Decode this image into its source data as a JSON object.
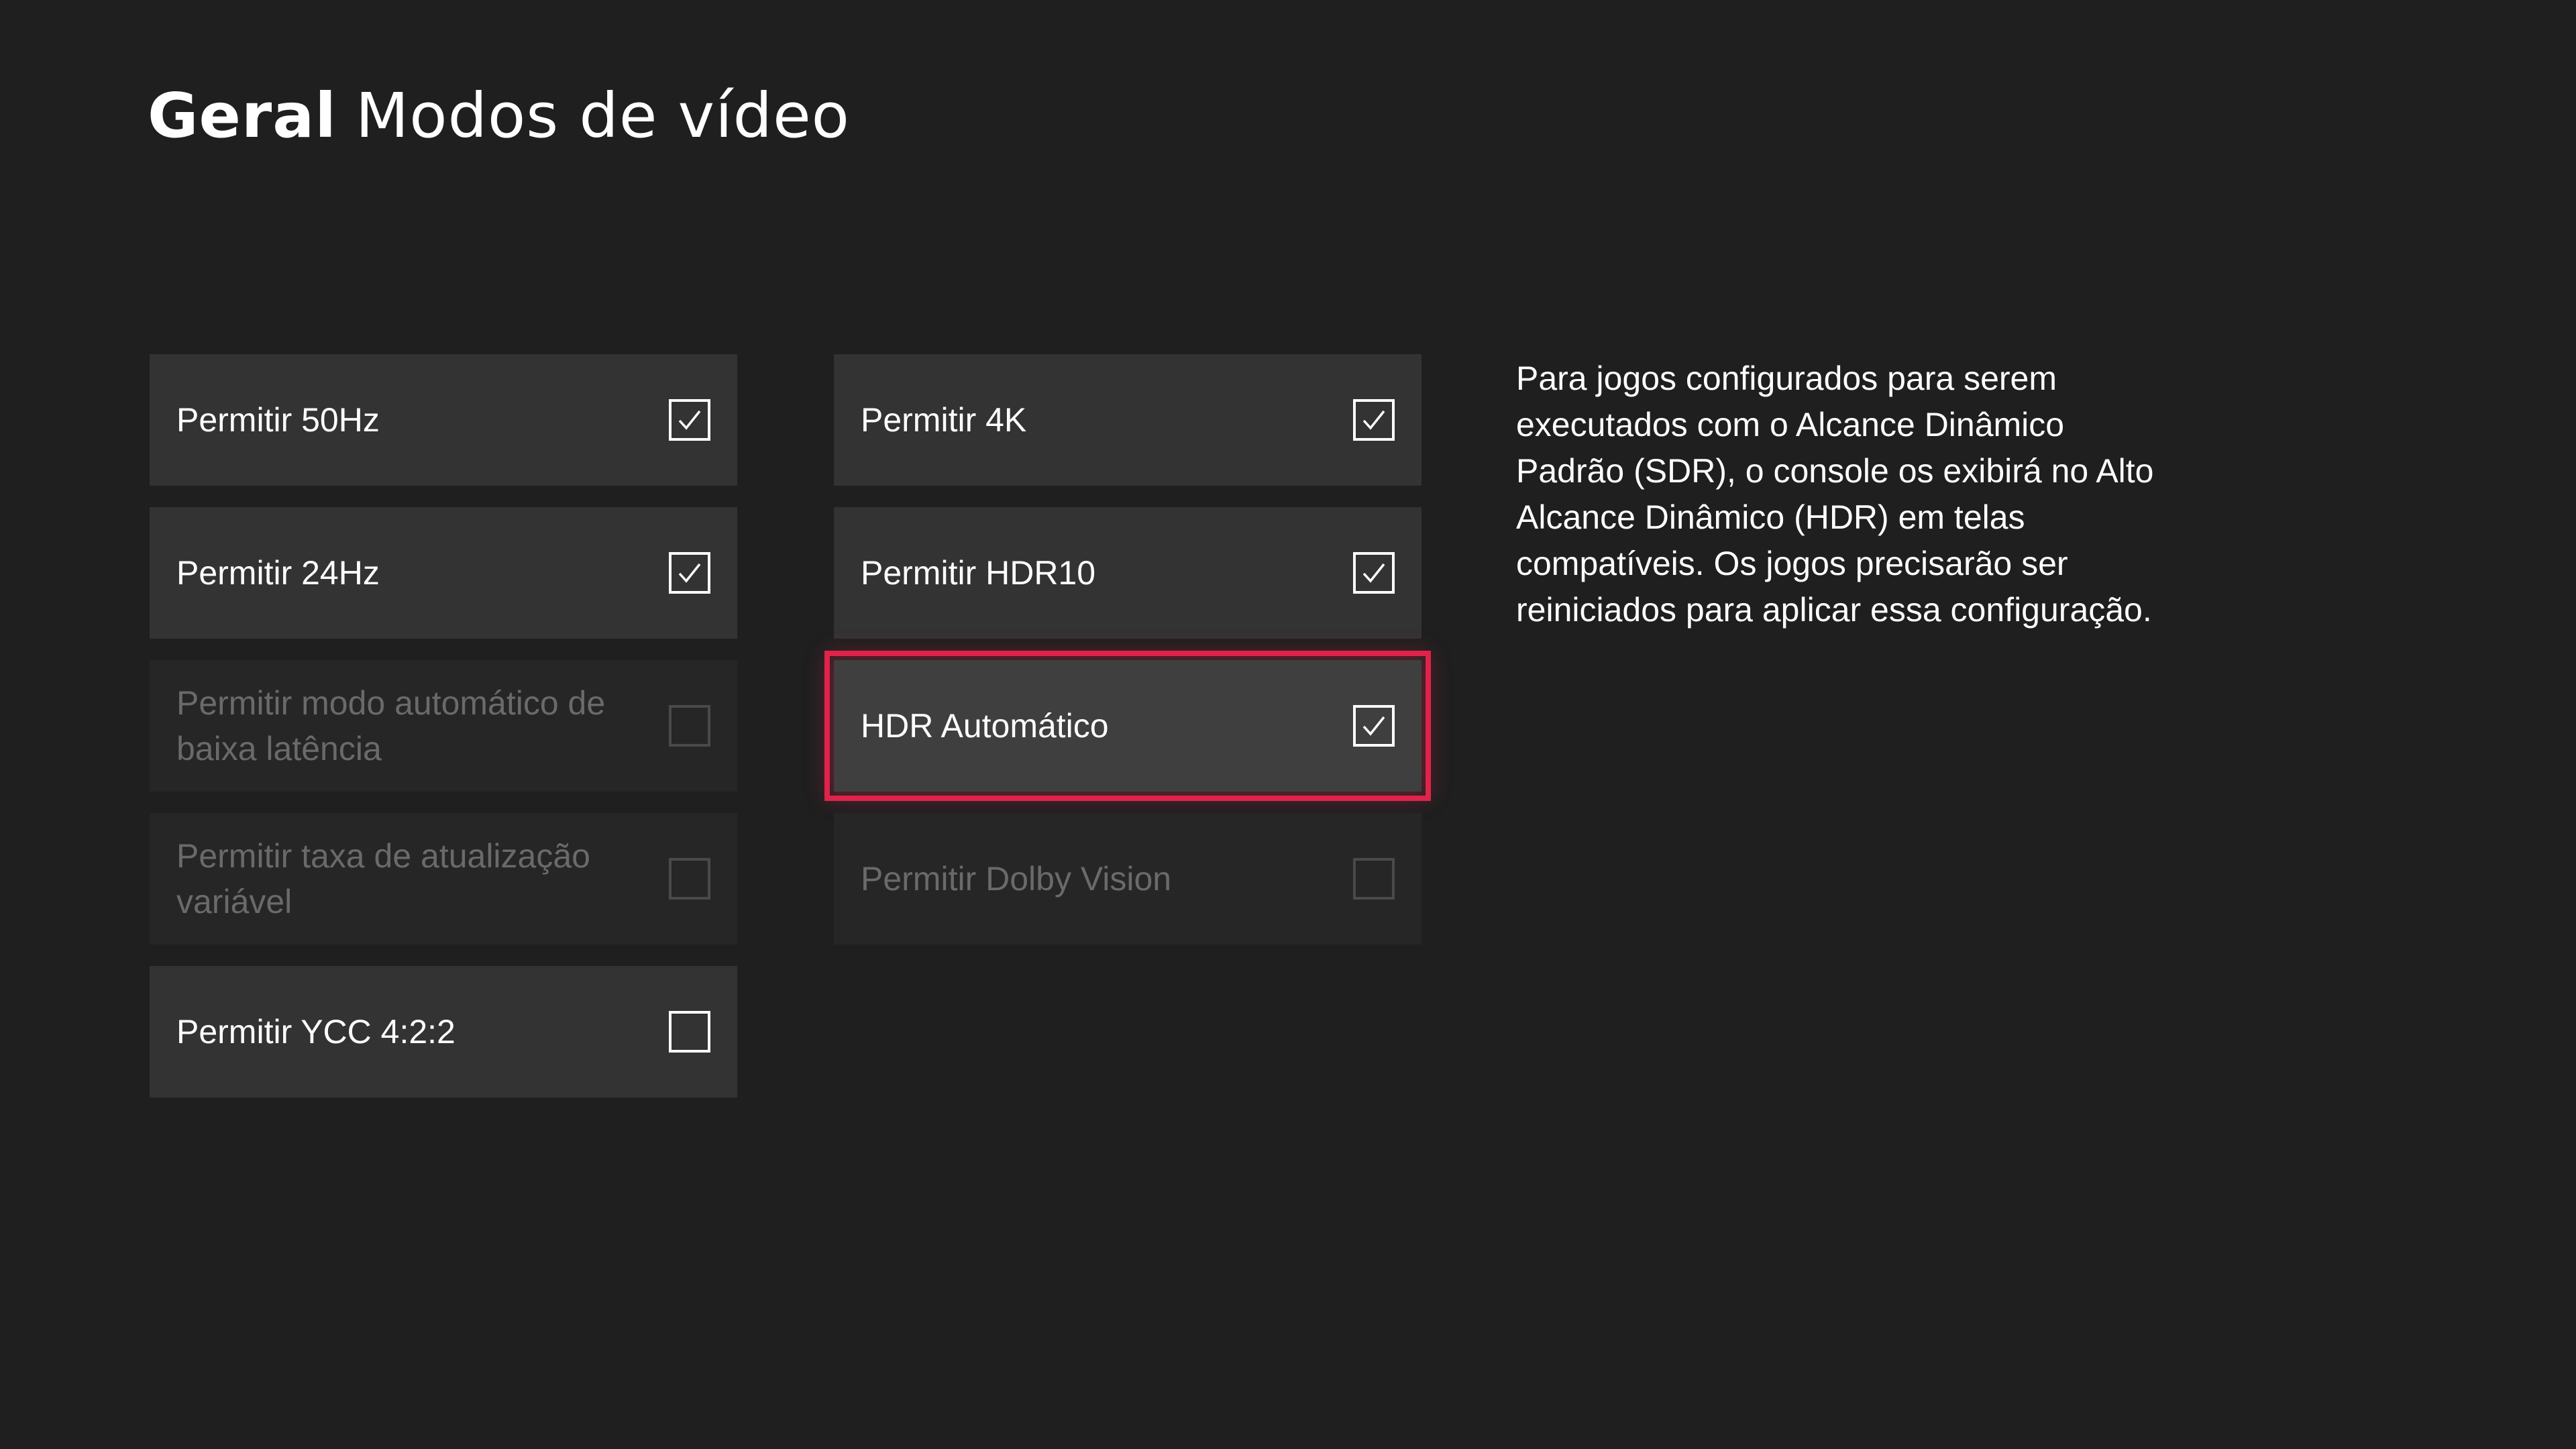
{
  "header": {
    "section": "Geral",
    "title": "Modos de vídeo"
  },
  "options_left": [
    {
      "label": "Permitir 50Hz",
      "checked": true,
      "enabled": true
    },
    {
      "label": "Permitir 24Hz",
      "checked": true,
      "enabled": true
    },
    {
      "label": "Permitir modo automático de baixa latência",
      "checked": false,
      "enabled": false
    },
    {
      "label": "Permitir taxa de atualização variável",
      "checked": false,
      "enabled": false
    },
    {
      "label": "Permitir YCC 4:2:2",
      "checked": false,
      "enabled": true
    }
  ],
  "options_right": [
    {
      "label": "Permitir 4K",
      "checked": true,
      "enabled": true
    },
    {
      "label": "Permitir HDR10",
      "checked": true,
      "enabled": true
    },
    {
      "label": "HDR Automático",
      "checked": true,
      "enabled": true,
      "focused": true
    },
    {
      "label": "Permitir Dolby Vision",
      "checked": false,
      "enabled": false
    }
  ],
  "description": "Para jogos configurados para serem executados com o Alcance Dinâmico Padrão (SDR), o console os exibirá no Alto Alcance Dinâmico (HDR) em telas compatíveis. Os jogos precisarão ser reiniciados para aplicar essa configuração.",
  "colors": {
    "background": "#1f1f1f",
    "tile": "#333333",
    "tile_disabled": "#262626",
    "focus": "#e0234a"
  }
}
